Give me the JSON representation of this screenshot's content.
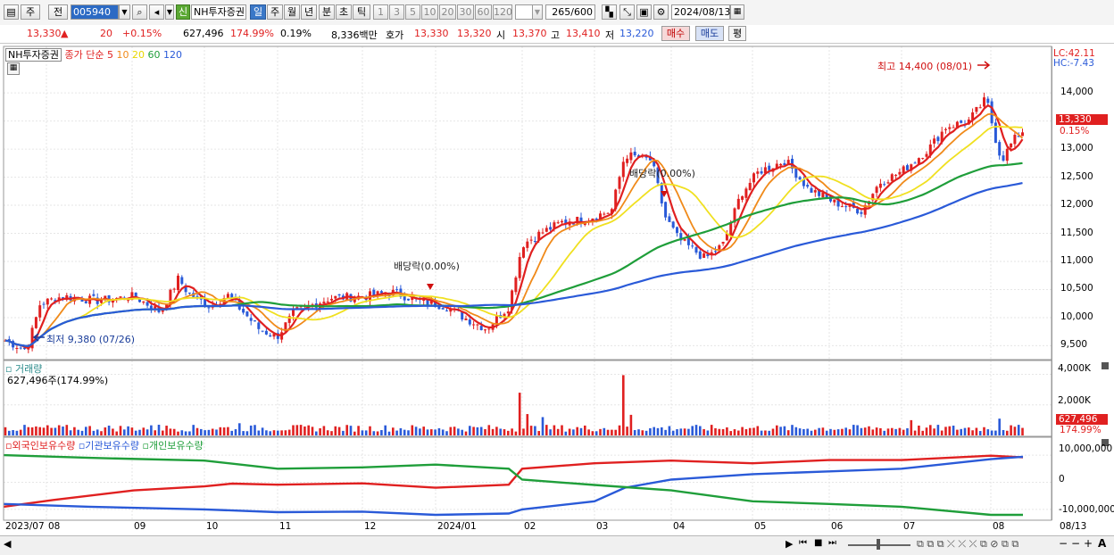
{
  "toolbar": {
    "market": "주",
    "prev": "전",
    "stock_code": "005940",
    "new_badge": "신",
    "stock_name": "NH투자증권",
    "periods": [
      "일",
      "주",
      "월",
      "년",
      "분",
      "초",
      "틱"
    ],
    "intervals": [
      "1",
      "3",
      "5",
      "10",
      "20",
      "30",
      "60",
      "120"
    ],
    "bar_count": "265",
    "bar_total": "/600",
    "date": "2024/08/13"
  },
  "quote": {
    "price": "13,330",
    "change_arrow": "▲",
    "change": "20",
    "change_pct": "+0.15%",
    "volume": "627,496",
    "volume_ratio": "174.99%",
    "turnover": "0.19%",
    "amount": "8,336백만",
    "hoga_label": "호가",
    "ask": "13,330",
    "bid": "13,320",
    "open_label": "시",
    "open": "13,370",
    "high_label": "고",
    "high": "13,410",
    "low_label": "저",
    "low": "13,220",
    "buy_button": "매수",
    "sell_button": "매도",
    "eval_button": "평"
  },
  "price_panel": {
    "title": "NH투자증권",
    "series_label": "종가 단순",
    "ma_periods": [
      "5",
      "10",
      "20",
      "60",
      "120"
    ],
    "ma_colors": [
      "#e02020",
      "#f08a1a",
      "#f0e020",
      "#1f9e3a",
      "#2a5ad8"
    ],
    "lc": "LC:42.11",
    "hc": "HC:-7.43",
    "current_price": "13,330",
    "current_pct": "0.15%",
    "y_ticks": [
      "14,000",
      "13,500",
      "13,000",
      "12,500",
      "12,000",
      "11,500",
      "11,000",
      "10,500",
      "10,000",
      "9,500"
    ],
    "annot_high": "최고 14,400 (08/01)",
    "annot_low": "최저 9,380 (07/26)",
    "annot_div1": "배당락(0.00%)",
    "annot_div2": "배당락(0.00%)"
  },
  "volume_panel": {
    "title": "거래량",
    "value_label": "627,496주(174.99%)",
    "y_ticks": [
      "4,000K",
      "2,000K"
    ],
    "current": "627,496",
    "current_pct": "174.99%"
  },
  "holdings_panel": {
    "labels": [
      "외국인보유수량",
      "기관보유수량",
      "개인보유수량"
    ],
    "colors": [
      "#e02020",
      "#2a5ad8",
      "#1f9e3a"
    ],
    "y_ticks": [
      "10,000,000",
      "0",
      "-10,000,000"
    ]
  },
  "x_axis": {
    "labels": [
      "2023/07",
      "08",
      "09",
      "10",
      "11",
      "12",
      "2024/01",
      "02",
      "03",
      "04",
      "05",
      "06",
      "07",
      "08",
      "08/13"
    ]
  },
  "chart_data": {
    "type": "line",
    "title": "NH투자증권",
    "price": {
      "x": [
        "2023/07",
        "2023/08",
        "2023/09",
        "2023/10",
        "2023/11",
        "2023/12",
        "2024/01",
        "2024/02",
        "2024/03",
        "2024/04",
        "2024/05",
        "2024/06",
        "2024/07",
        "2024/08"
      ],
      "close_approx": [
        9600,
        10350,
        10300,
        10500,
        10100,
        10400,
        9850,
        11500,
        12800,
        11100,
        12800,
        12000,
        13200,
        13330
      ],
      "ylim": [
        9300,
        14400
      ],
      "high": 14400,
      "low": 9380,
      "last": 13330
    },
    "volume": {
      "ylim": [
        0,
        4500
      ],
      "unit": "K",
      "last": 627.496
    },
    "holdings": {
      "series": [
        "외국인보유수량",
        "기관보유수량",
        "개인보유수량"
      ],
      "ylim": [
        -12000000,
        12000000
      ]
    }
  }
}
